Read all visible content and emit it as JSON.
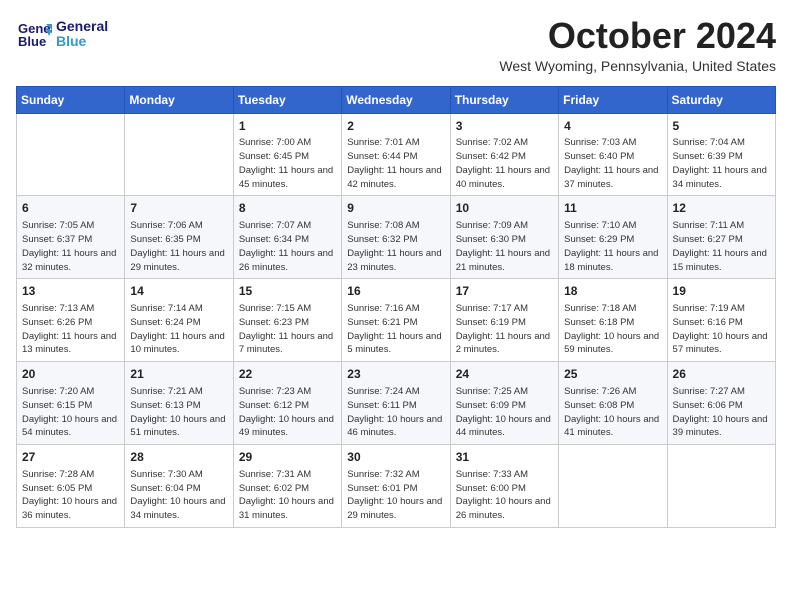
{
  "header": {
    "logo_line1": "General",
    "logo_line2": "Blue",
    "month": "October 2024",
    "location": "West Wyoming, Pennsylvania, United States"
  },
  "weekdays": [
    "Sunday",
    "Monday",
    "Tuesday",
    "Wednesday",
    "Thursday",
    "Friday",
    "Saturday"
  ],
  "weeks": [
    [
      {
        "day": "",
        "info": ""
      },
      {
        "day": "",
        "info": ""
      },
      {
        "day": "1",
        "info": "Sunrise: 7:00 AM\nSunset: 6:45 PM\nDaylight: 11 hours and 45 minutes."
      },
      {
        "day": "2",
        "info": "Sunrise: 7:01 AM\nSunset: 6:44 PM\nDaylight: 11 hours and 42 minutes."
      },
      {
        "day": "3",
        "info": "Sunrise: 7:02 AM\nSunset: 6:42 PM\nDaylight: 11 hours and 40 minutes."
      },
      {
        "day": "4",
        "info": "Sunrise: 7:03 AM\nSunset: 6:40 PM\nDaylight: 11 hours and 37 minutes."
      },
      {
        "day": "5",
        "info": "Sunrise: 7:04 AM\nSunset: 6:39 PM\nDaylight: 11 hours and 34 minutes."
      }
    ],
    [
      {
        "day": "6",
        "info": "Sunrise: 7:05 AM\nSunset: 6:37 PM\nDaylight: 11 hours and 32 minutes."
      },
      {
        "day": "7",
        "info": "Sunrise: 7:06 AM\nSunset: 6:35 PM\nDaylight: 11 hours and 29 minutes."
      },
      {
        "day": "8",
        "info": "Sunrise: 7:07 AM\nSunset: 6:34 PM\nDaylight: 11 hours and 26 minutes."
      },
      {
        "day": "9",
        "info": "Sunrise: 7:08 AM\nSunset: 6:32 PM\nDaylight: 11 hours and 23 minutes."
      },
      {
        "day": "10",
        "info": "Sunrise: 7:09 AM\nSunset: 6:30 PM\nDaylight: 11 hours and 21 minutes."
      },
      {
        "day": "11",
        "info": "Sunrise: 7:10 AM\nSunset: 6:29 PM\nDaylight: 11 hours and 18 minutes."
      },
      {
        "day": "12",
        "info": "Sunrise: 7:11 AM\nSunset: 6:27 PM\nDaylight: 11 hours and 15 minutes."
      }
    ],
    [
      {
        "day": "13",
        "info": "Sunrise: 7:13 AM\nSunset: 6:26 PM\nDaylight: 11 hours and 13 minutes."
      },
      {
        "day": "14",
        "info": "Sunrise: 7:14 AM\nSunset: 6:24 PM\nDaylight: 11 hours and 10 minutes."
      },
      {
        "day": "15",
        "info": "Sunrise: 7:15 AM\nSunset: 6:23 PM\nDaylight: 11 hours and 7 minutes."
      },
      {
        "day": "16",
        "info": "Sunrise: 7:16 AM\nSunset: 6:21 PM\nDaylight: 11 hours and 5 minutes."
      },
      {
        "day": "17",
        "info": "Sunrise: 7:17 AM\nSunset: 6:19 PM\nDaylight: 11 hours and 2 minutes."
      },
      {
        "day": "18",
        "info": "Sunrise: 7:18 AM\nSunset: 6:18 PM\nDaylight: 10 hours and 59 minutes."
      },
      {
        "day": "19",
        "info": "Sunrise: 7:19 AM\nSunset: 6:16 PM\nDaylight: 10 hours and 57 minutes."
      }
    ],
    [
      {
        "day": "20",
        "info": "Sunrise: 7:20 AM\nSunset: 6:15 PM\nDaylight: 10 hours and 54 minutes."
      },
      {
        "day": "21",
        "info": "Sunrise: 7:21 AM\nSunset: 6:13 PM\nDaylight: 10 hours and 51 minutes."
      },
      {
        "day": "22",
        "info": "Sunrise: 7:23 AM\nSunset: 6:12 PM\nDaylight: 10 hours and 49 minutes."
      },
      {
        "day": "23",
        "info": "Sunrise: 7:24 AM\nSunset: 6:11 PM\nDaylight: 10 hours and 46 minutes."
      },
      {
        "day": "24",
        "info": "Sunrise: 7:25 AM\nSunset: 6:09 PM\nDaylight: 10 hours and 44 minutes."
      },
      {
        "day": "25",
        "info": "Sunrise: 7:26 AM\nSunset: 6:08 PM\nDaylight: 10 hours and 41 minutes."
      },
      {
        "day": "26",
        "info": "Sunrise: 7:27 AM\nSunset: 6:06 PM\nDaylight: 10 hours and 39 minutes."
      }
    ],
    [
      {
        "day": "27",
        "info": "Sunrise: 7:28 AM\nSunset: 6:05 PM\nDaylight: 10 hours and 36 minutes."
      },
      {
        "day": "28",
        "info": "Sunrise: 7:30 AM\nSunset: 6:04 PM\nDaylight: 10 hours and 34 minutes."
      },
      {
        "day": "29",
        "info": "Sunrise: 7:31 AM\nSunset: 6:02 PM\nDaylight: 10 hours and 31 minutes."
      },
      {
        "day": "30",
        "info": "Sunrise: 7:32 AM\nSunset: 6:01 PM\nDaylight: 10 hours and 29 minutes."
      },
      {
        "day": "31",
        "info": "Sunrise: 7:33 AM\nSunset: 6:00 PM\nDaylight: 10 hours and 26 minutes."
      },
      {
        "day": "",
        "info": ""
      },
      {
        "day": "",
        "info": ""
      }
    ]
  ]
}
